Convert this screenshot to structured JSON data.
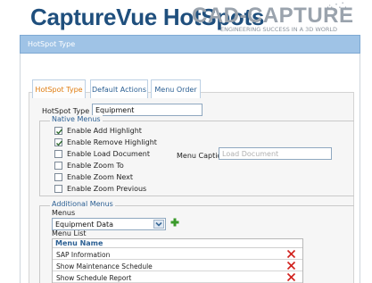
{
  "header": {
    "app_title": "CaptureVue HotSpots",
    "brand": "CAD-CAPTURE",
    "tagline": "ENGINEERING SUCCESS IN A 3D WORLD"
  },
  "window": {
    "title": "HotSpot Type"
  },
  "tabs": [
    {
      "label": "HotSpot Type",
      "active": true
    },
    {
      "label": "Default Actions",
      "active": false
    },
    {
      "label": "Menu Order",
      "active": false
    }
  ],
  "form": {
    "hotspot_type_label": "HotSpot Type",
    "hotspot_type_value": "Equipment"
  },
  "native_menus": {
    "legend": "Native Menus",
    "options": [
      {
        "label": "Enable Add Highlight",
        "checked": true
      },
      {
        "label": "Enable Remove Highlight",
        "checked": true
      },
      {
        "label": "Enable Load Document",
        "checked": false
      },
      {
        "label": "Enable Zoom To",
        "checked": false
      },
      {
        "label": "Enable Zoom Next",
        "checked": false
      },
      {
        "label": "Enable Zoom Previous",
        "checked": false
      }
    ],
    "menu_caption_label": "Menu Caption",
    "menu_caption_placeholder": "Load Document"
  },
  "additional_menus": {
    "legend": "Additional Menus",
    "menus_label": "Menus",
    "menus_selected": "Equipment Data",
    "menu_list_label": "Menu List",
    "table_header": "Menu Name",
    "rows": [
      {
        "name": "SAP Information"
      },
      {
        "name": "Show Maintenance Schedule"
      },
      {
        "name": "Show Schedule Report"
      }
    ]
  },
  "colors": {
    "accent": "#2b5f93",
    "active_tab": "#e07d10",
    "titlebar": "#9fc3e6",
    "delete": "#d0201c",
    "add": "#3a9a2a"
  }
}
